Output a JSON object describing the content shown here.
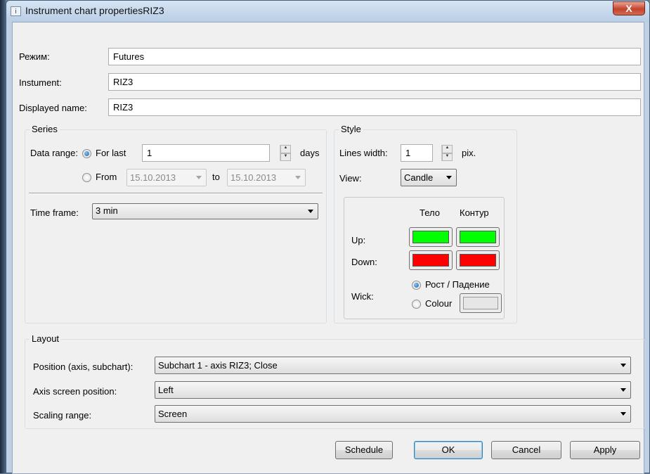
{
  "window": {
    "title": "Instrument chart propertiesRIZ3",
    "close": "X"
  },
  "fields": {
    "mode": {
      "label": "Режим:",
      "value": "Futures"
    },
    "instrument": {
      "label": "Instument:",
      "value": "RIZ3"
    },
    "displayed_name": {
      "label": "Displayed name:",
      "value": "RIZ3"
    }
  },
  "series": {
    "title": "Series",
    "data_range_label": "Data range:",
    "for_last_label": "For last",
    "for_last_value": "1",
    "days_label": "days",
    "from_label": "From",
    "from_date": "15.10.2013",
    "to_label": "to",
    "to_date": "15.10.2013",
    "time_frame_label": "Time frame:",
    "time_frame_value": "3 min"
  },
  "style": {
    "title": "Style",
    "lines_width_label": "Lines width:",
    "lines_width_value": "1",
    "pix_label": "pix.",
    "view_label": "View:",
    "view_value": "Candle",
    "col_body": "Тело",
    "col_outline": "Контур",
    "up_label": "Up:",
    "down_label": "Down:",
    "wick_label": "Wick:",
    "wick_option_growth": "Рост / Падение",
    "wick_option_colour": "Colour",
    "colors": {
      "up_body": "#00ff00",
      "up_outline": "#00ff00",
      "down_body": "#ff0000",
      "down_outline": "#ff0000",
      "wick_colour": "#e6e6e6"
    }
  },
  "layout": {
    "title": "Layout",
    "position_label": "Position (axis, subchart):",
    "position_value": "Subchart 1 - axis RIZ3; Close",
    "axis_screen_label": "Axis screen position:",
    "axis_screen_value": "Left",
    "scaling_label": "Scaling range:",
    "scaling_value": "Screen"
  },
  "buttons": {
    "schedule": "Schedule",
    "ok": "OK",
    "cancel": "Cancel",
    "apply": "Apply"
  }
}
